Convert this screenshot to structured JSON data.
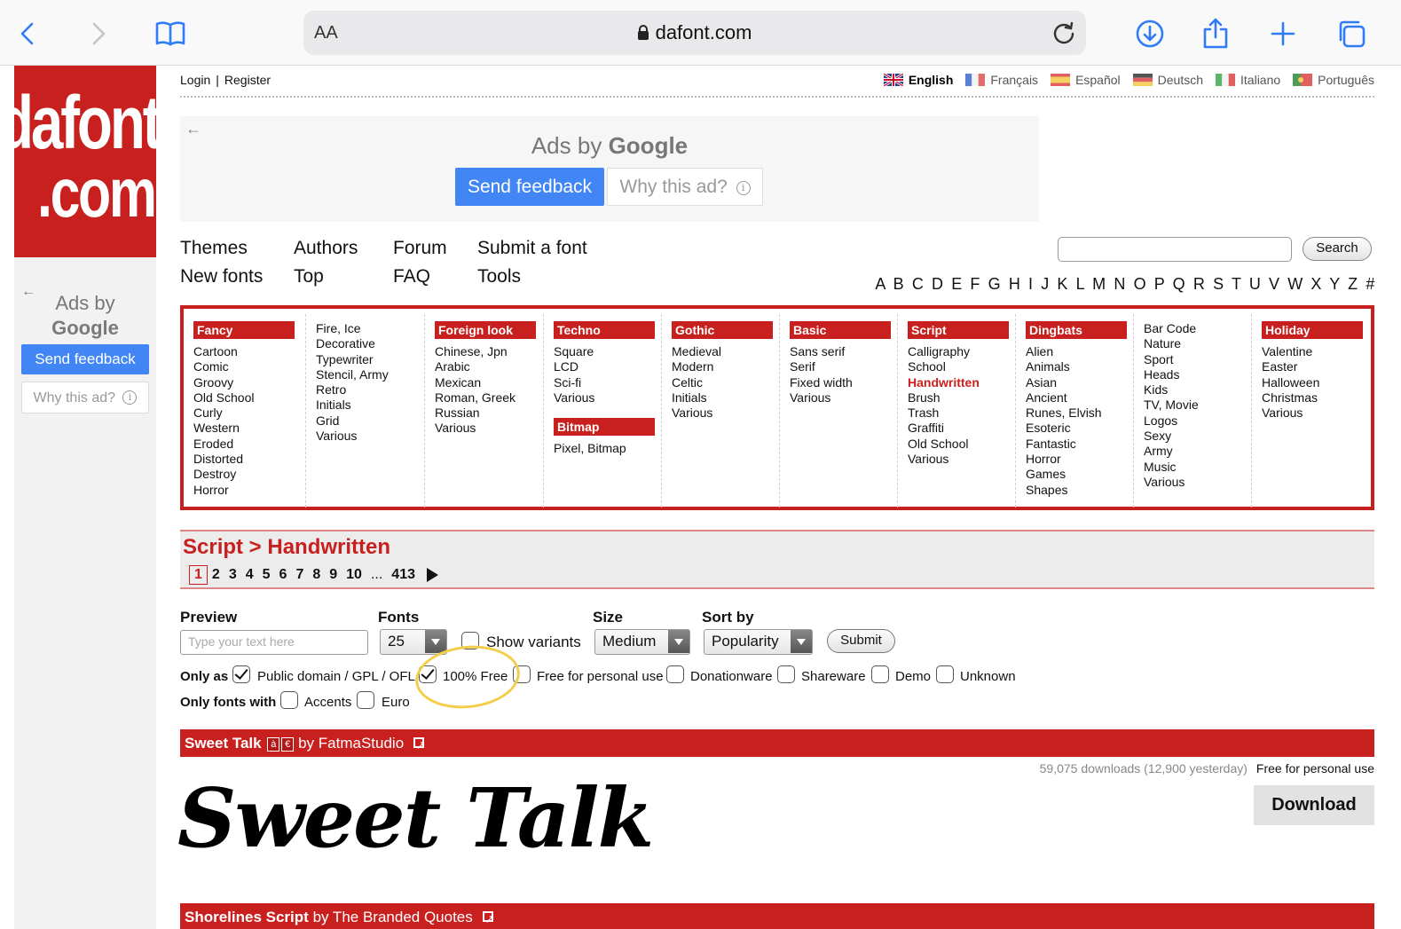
{
  "browser": {
    "text_size_label": "AA",
    "url": "dafont.com"
  },
  "header": {
    "login": "Login",
    "register": "Register",
    "separator": "|",
    "languages": [
      {
        "name": "English",
        "active": true
      },
      {
        "name": "Français",
        "active": false
      },
      {
        "name": "Español",
        "active": false
      },
      {
        "name": "Deutsch",
        "active": false
      },
      {
        "name": "Italiano",
        "active": false
      },
      {
        "name": "Português",
        "active": false
      }
    ]
  },
  "logo": {
    "line1": "dafont",
    "line2": ".com"
  },
  "ads": {
    "ads_by": "Ads by",
    "google": "Google",
    "send_feedback": "Send feedback",
    "why_this_ad": "Why this ad?",
    "info_glyph": "i"
  },
  "nav": {
    "themes": "Themes",
    "authors": "Authors",
    "forum": "Forum",
    "submit_font": "Submit a font",
    "new_fonts": "New fonts",
    "top": "Top",
    "faq": "FAQ",
    "tools": "Tools",
    "search_button": "Search",
    "alphabet": "A B C D E F G H I J K L M N O P Q R S T U V W X Y Z #"
  },
  "categories": {
    "fancy": {
      "title": "Fancy",
      "items": [
        "Cartoon",
        "Comic",
        "Groovy",
        "Old School",
        "Curly",
        "Western",
        "Eroded",
        "Distorted",
        "Destroy",
        "Horror"
      ]
    },
    "fancy2": {
      "items": [
        "Fire, Ice",
        "Decorative",
        "Typewriter",
        "Stencil, Army",
        "Retro",
        "Initials",
        "Grid",
        "Various"
      ]
    },
    "foreign": {
      "title": "Foreign look",
      "items": [
        "Chinese, Jpn",
        "Arabic",
        "Mexican",
        "Roman, Greek",
        "Russian",
        "Various"
      ]
    },
    "techno": {
      "title": "Techno",
      "items": [
        "Square",
        "LCD",
        "Sci-fi",
        "Various"
      ]
    },
    "bitmap": {
      "title": "Bitmap",
      "items": [
        "Pixel, Bitmap"
      ]
    },
    "gothic": {
      "title": "Gothic",
      "items": [
        "Medieval",
        "Modern",
        "Celtic",
        "Initials",
        "Various"
      ]
    },
    "basic": {
      "title": "Basic",
      "items": [
        "Sans serif",
        "Serif",
        "Fixed width",
        "Various"
      ]
    },
    "script": {
      "title": "Script",
      "items": [
        "Calligraphy",
        "School",
        "Handwritten",
        "Brush",
        "Trash",
        "Graffiti",
        "Old School",
        "Various"
      ],
      "active": "Handwritten"
    },
    "dingbats": {
      "title": "Dingbats",
      "items": [
        "Alien",
        "Animals",
        "Asian",
        "Ancient",
        "Runes, Elvish",
        "Esoteric",
        "Fantastic",
        "Horror",
        "Games",
        "Shapes"
      ]
    },
    "dingbats2": {
      "items": [
        "Bar Code",
        "Nature",
        "Sport",
        "Heads",
        "Kids",
        "TV, Movie",
        "Logos",
        "Sexy",
        "Army",
        "Music",
        "Various"
      ]
    },
    "holiday": {
      "title": "Holiday",
      "items": [
        "Valentine",
        "Easter",
        "Halloween",
        "Christmas",
        "Various"
      ]
    }
  },
  "breadcrumb": {
    "title": "Script > Handwritten",
    "pages": [
      "1",
      "2",
      "3",
      "4",
      "5",
      "6",
      "7",
      "8",
      "9",
      "10",
      "...",
      "413"
    ],
    "current_page": "1"
  },
  "filters": {
    "preview_label": "Preview",
    "preview_placeholder": "Type your text here",
    "fonts_label": "Fonts",
    "fonts_value": "25",
    "show_variants": "Show variants",
    "size_label": "Size",
    "size_value": "Medium",
    "sort_label": "Sort by",
    "sort_value": "Popularity",
    "submit": "Submit",
    "only_as": "Only as",
    "public_domain": "Public domain / GPL / OFL",
    "free100": "100% Free",
    "free_personal": "Free for personal use",
    "donationware": "Donationware",
    "shareware": "Shareware",
    "demo": "Demo",
    "unknown": "Unknown",
    "only_fonts_with": "Only fonts with",
    "accents": "Accents",
    "euro": "Euro"
  },
  "fonts": [
    {
      "name": "Sweet Talk",
      "badge_a": "à",
      "badge_e": "€",
      "by": "by FatmaStudio",
      "downloads": "59,075 downloads (12,900 yesterday)",
      "license": "Free for personal use",
      "download_label": "Download",
      "sample": "Sweet Talk"
    },
    {
      "name": "Shorelines Script",
      "by": "by The Branded Quotes"
    }
  ],
  "colors": {
    "brand_red": "#c8201f",
    "safari_blue": "#2f7cf6",
    "google_blue": "#4285f4",
    "highlight": "#f2cf4a"
  }
}
